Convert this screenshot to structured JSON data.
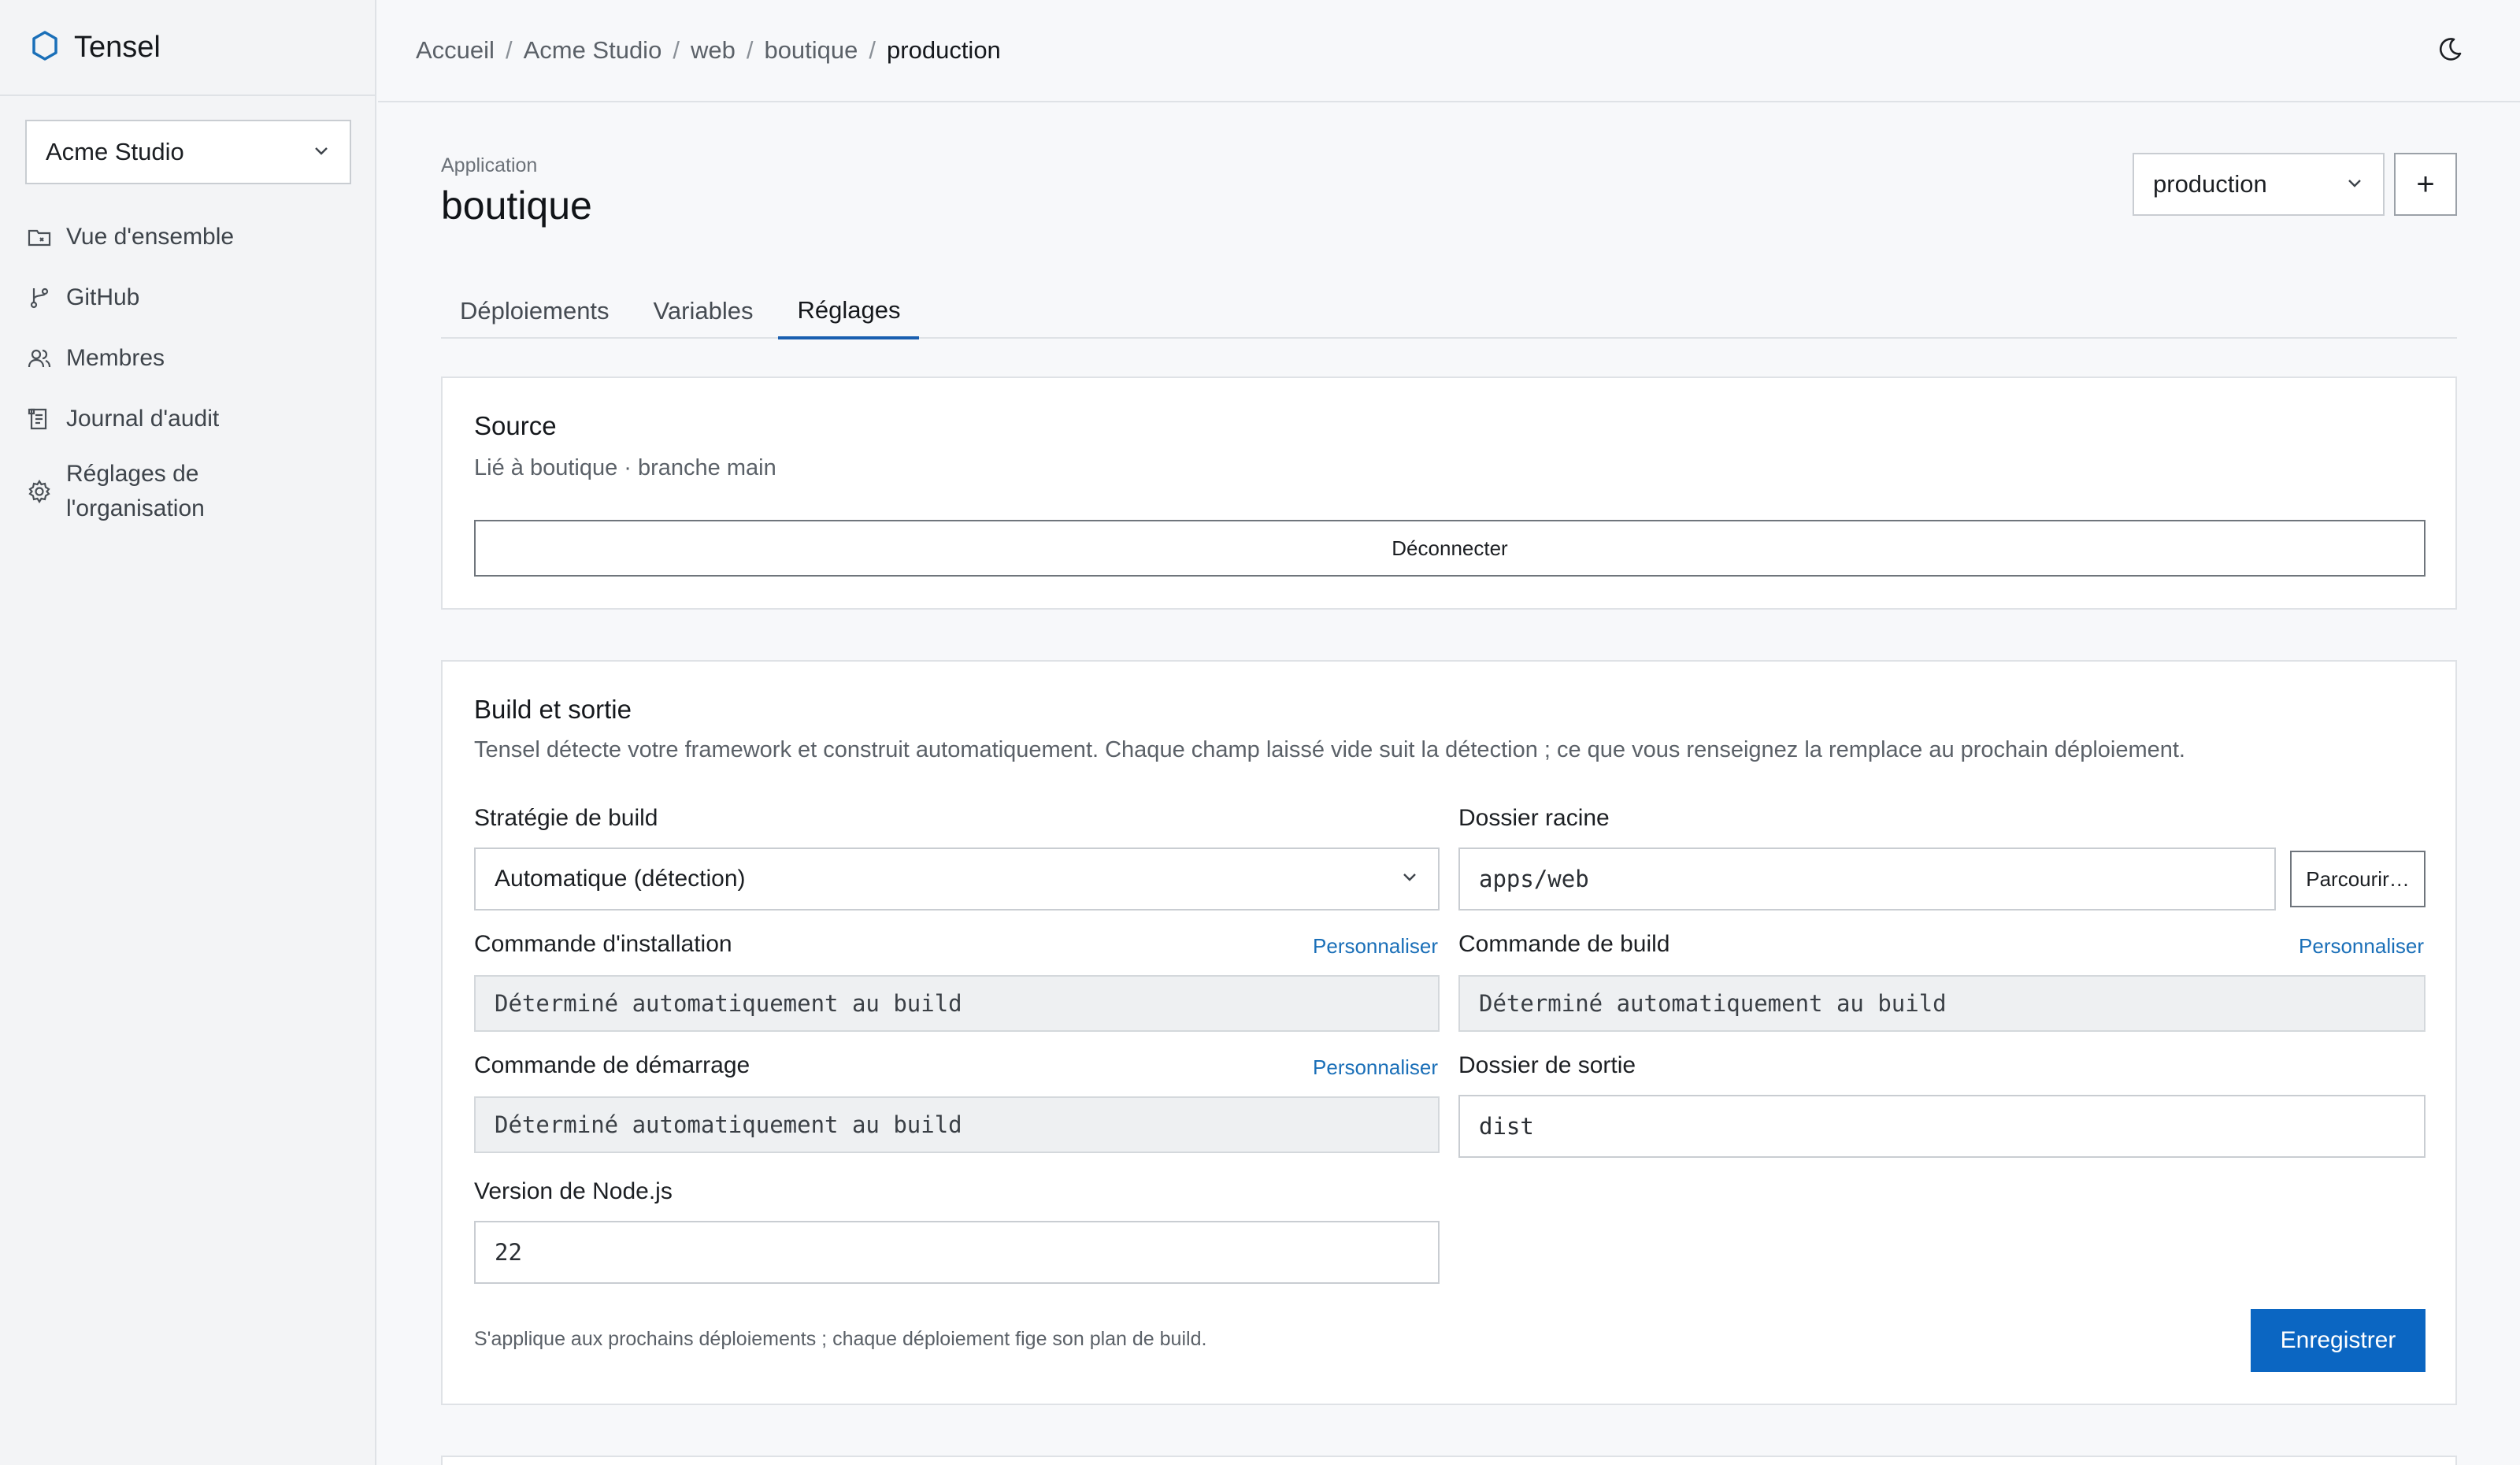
{
  "app": {
    "name": "Tensel",
    "brand_color": "#1a6fb8"
  },
  "sidebar": {
    "org_select": {
      "value": "Acme Studio"
    },
    "items": [
      {
        "label": "Vue d'ensemble",
        "icon": "overview-icon"
      },
      {
        "label": "GitHub",
        "icon": "git-branch-icon"
      },
      {
        "label": "Membres",
        "icon": "users-icon"
      },
      {
        "label": "Journal d'audit",
        "icon": "audit-log-icon"
      },
      {
        "label_line1": "Réglages de",
        "label_line2": "l'organisation",
        "icon": "gear-icon"
      }
    ]
  },
  "breadcrumb": [
    "Accueil",
    "Acme Studio",
    "web",
    "boutique",
    "production"
  ],
  "header": {
    "kicker": "Application",
    "title": "boutique",
    "env_select": "production",
    "add_label": "+"
  },
  "tabs": [
    {
      "label": "Déploiements",
      "active": false
    },
    {
      "label": "Variables",
      "active": false
    },
    {
      "label": "Réglages",
      "active": true
    }
  ],
  "source": {
    "title": "Source",
    "description": "Lié à boutique · branche main",
    "disconnect_label": "Déconnecter"
  },
  "build": {
    "title": "Build et sortie",
    "description": "Tensel détecte votre framework et construit automatiquement. Chaque champ laissé vide suit la détection ; ce que vous renseignez la remplace au prochain déploiement.",
    "strategy": {
      "label": "Stratégie de build",
      "value": "Automatique (détection)"
    },
    "root_dir": {
      "label": "Dossier racine",
      "value": "apps/web",
      "browse_label": "Parcourir…"
    },
    "install_cmd": {
      "label": "Commande d'installation",
      "value": "Déterminé automatiquement au build",
      "customize": "Personnaliser"
    },
    "build_cmd": {
      "label": "Commande de build",
      "value": "Déterminé automatiquement au build",
      "customize": "Personnaliser"
    },
    "start_cmd": {
      "label": "Commande de démarrage",
      "value": "Déterminé automatiquement au build",
      "customize": "Personnaliser"
    },
    "output_dir": {
      "label": "Dossier de sortie",
      "value": "dist"
    },
    "node_version": {
      "label": "Version de Node.js",
      "value": "22"
    },
    "footnote": "S'applique aux prochains déploiements ; chaque déploiement fige son plan de build.",
    "save_label": "Enregistrer",
    "save_color": "#0b66c2"
  }
}
